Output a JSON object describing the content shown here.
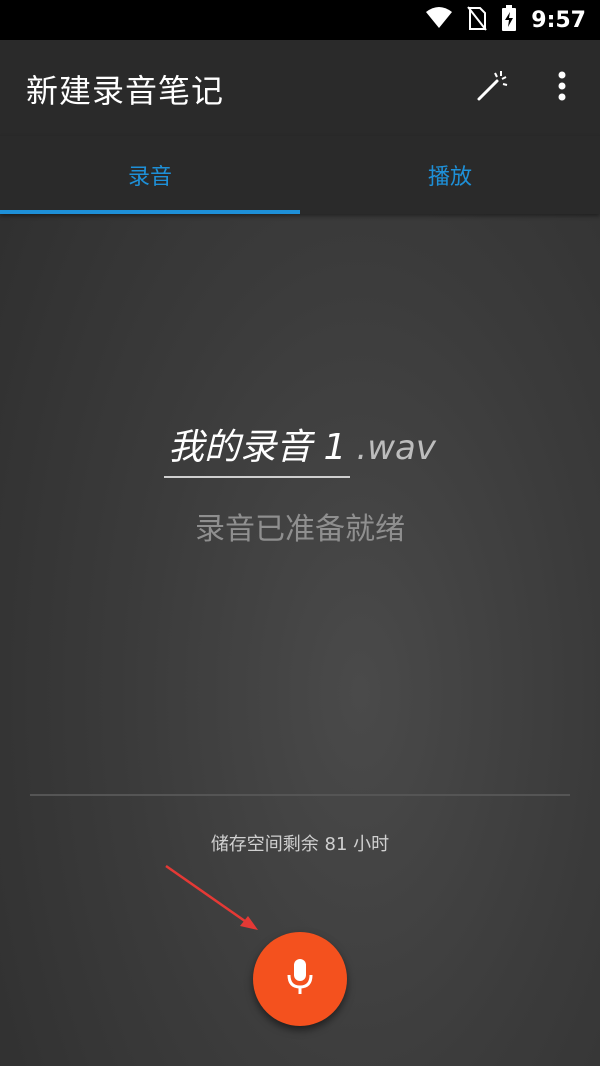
{
  "status_bar": {
    "time": "9:57",
    "icons": [
      "wifi-icon",
      "no-sim-icon",
      "battery-charging-icon"
    ]
  },
  "app_bar": {
    "title": "新建录音笔记",
    "actions": [
      "magic-wand-icon",
      "more-vert-icon"
    ]
  },
  "tabs": [
    {
      "label": "录音",
      "selected": true
    },
    {
      "label": "播放",
      "selected": false
    }
  ],
  "recording": {
    "file_name": "我的录音 1",
    "file_ext": ".wav",
    "status": "录音已准备就绪",
    "storage_remaining": "储存空间剩余 81 小时"
  },
  "record_button": {
    "icon": "microphone-icon"
  },
  "colors": {
    "accent": "#1e90d8",
    "record": "#f4511e",
    "annotation_arrow": "#e53935"
  }
}
